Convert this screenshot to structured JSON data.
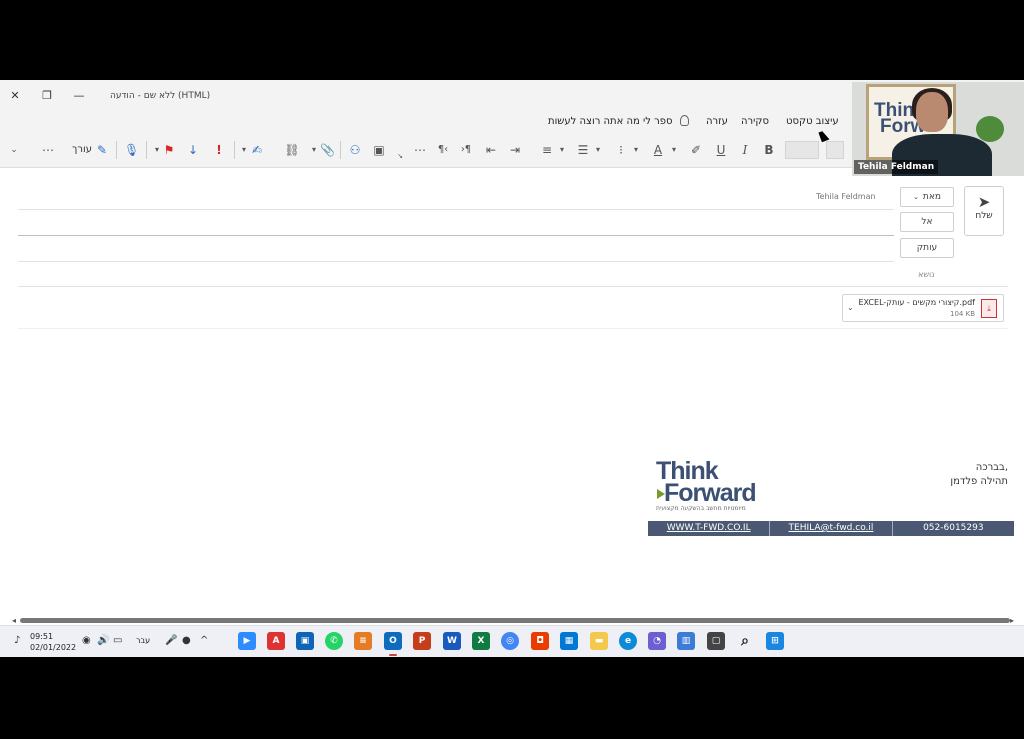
{
  "window": {
    "title": "ללא שם  -  הודעה (HTML)"
  },
  "menu": {
    "items": [
      "עיצוב טקסט",
      "סקירה",
      "עזרה"
    ],
    "tell_me": "ספר לי מה אתה רוצה לעשות"
  },
  "ribbon": {
    "editor_label": "עורך"
  },
  "compose": {
    "send_label": "שלח",
    "from_button": "מאת",
    "from_name": "Tehila Feldman",
    "to_button": "אל",
    "cc_button": "עותק",
    "subject_label": "נושא"
  },
  "attachment": {
    "name": "EXCEL-קיצורי מקשים - עותק.pdf",
    "size": "104 KB"
  },
  "signature": {
    "greeting": "בברכה,",
    "name": "תהילה פלדמן",
    "logo_line1": "Think",
    "logo_line2": "Forward",
    "logo_tagline": "מיומנויות מחשב בהשקעה מקצועית",
    "website": "WWW.T-FWD.CO.IL",
    "email": "TEHILA@t-fwd.co.il",
    "phone": "052-6015293"
  },
  "taskbar": {
    "time": "09:51",
    "date": "02/01/2022",
    "language": "עבר"
  },
  "webcam": {
    "name": "Tehila Feldman",
    "logo_line1": "Think",
    "logo_line2": "Forw"
  },
  "colors": {
    "signature_bar": "#4a5874",
    "logo_blue": "#3c4f74",
    "logo_green": "#7a9a2e"
  }
}
